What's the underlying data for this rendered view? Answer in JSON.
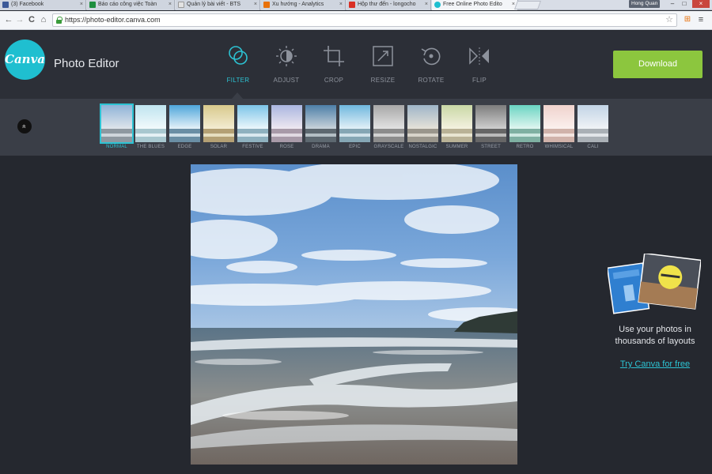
{
  "browser": {
    "tabs": [
      {
        "title": "(3) Facebook",
        "favicon_color": "#3b5998"
      },
      {
        "title": "Báo cáo công việc Toàn",
        "favicon_color": "#1e8e3e"
      },
      {
        "title": "Quản lý bài viết - BTS",
        "favicon_color": "#e3e3e3"
      },
      {
        "title": "Xu hướng - Analytics",
        "favicon_color": "#e8710a"
      },
      {
        "title": "Hộp thư đến - longocho",
        "favicon_color": "#d93025"
      },
      {
        "title": "Free Online Photo Edito",
        "favicon_color": "#1fbfd0"
      }
    ],
    "tab_close_glyph": "×",
    "profile_name": "Hong Quan",
    "window_controls": {
      "minimize": "–",
      "maximize": "□",
      "close": "×"
    },
    "nav": {
      "back": "←",
      "forward": "→",
      "reload": "C",
      "home": "⌂"
    },
    "url": "https://photo-editor.canva.com",
    "bookmark_glyph": "☆",
    "menu_glyph": "≡",
    "extension_glyph": "⊞"
  },
  "app": {
    "logo_text": "Canva",
    "title": "Photo Editor",
    "accent_color": "#2cc3d3",
    "tools": [
      {
        "label": "FILTER",
        "icon": "filter-icon",
        "active": true
      },
      {
        "label": "ADJUST",
        "icon": "adjust-icon",
        "active": false
      },
      {
        "label": "CROP",
        "icon": "crop-icon",
        "active": false
      },
      {
        "label": "RESIZE",
        "icon": "resize-icon",
        "active": false
      },
      {
        "label": "ROTATE",
        "icon": "rotate-icon",
        "active": false
      },
      {
        "label": "FLIP",
        "icon": "flip-icon",
        "active": false
      }
    ],
    "download_label": "Download",
    "download_color": "#8cc63e"
  },
  "filters": {
    "collapse_glyph": "«",
    "items": [
      {
        "label": "NORMAL",
        "active": true
      },
      {
        "label": "THE BLUES",
        "active": false
      },
      {
        "label": "EDGE",
        "active": false
      },
      {
        "label": "SOLAR",
        "active": false
      },
      {
        "label": "FESTIVE",
        "active": false
      },
      {
        "label": "ROSE",
        "active": false
      },
      {
        "label": "DRAMA",
        "active": false
      },
      {
        "label": "EPIC",
        "active": false
      },
      {
        "label": "GRAYSCALE",
        "active": false
      },
      {
        "label": "NOSTALGIC",
        "active": false
      },
      {
        "label": "SUMMER",
        "active": false
      },
      {
        "label": "STREET",
        "active": false
      },
      {
        "label": "RETRO",
        "active": false
      },
      {
        "label": "WHIMSICAL",
        "active": false
      },
      {
        "label": "CALI",
        "active": false
      }
    ]
  },
  "promo": {
    "text": "Use your photos in thousands of layouts",
    "link": "Try Canva for free"
  }
}
